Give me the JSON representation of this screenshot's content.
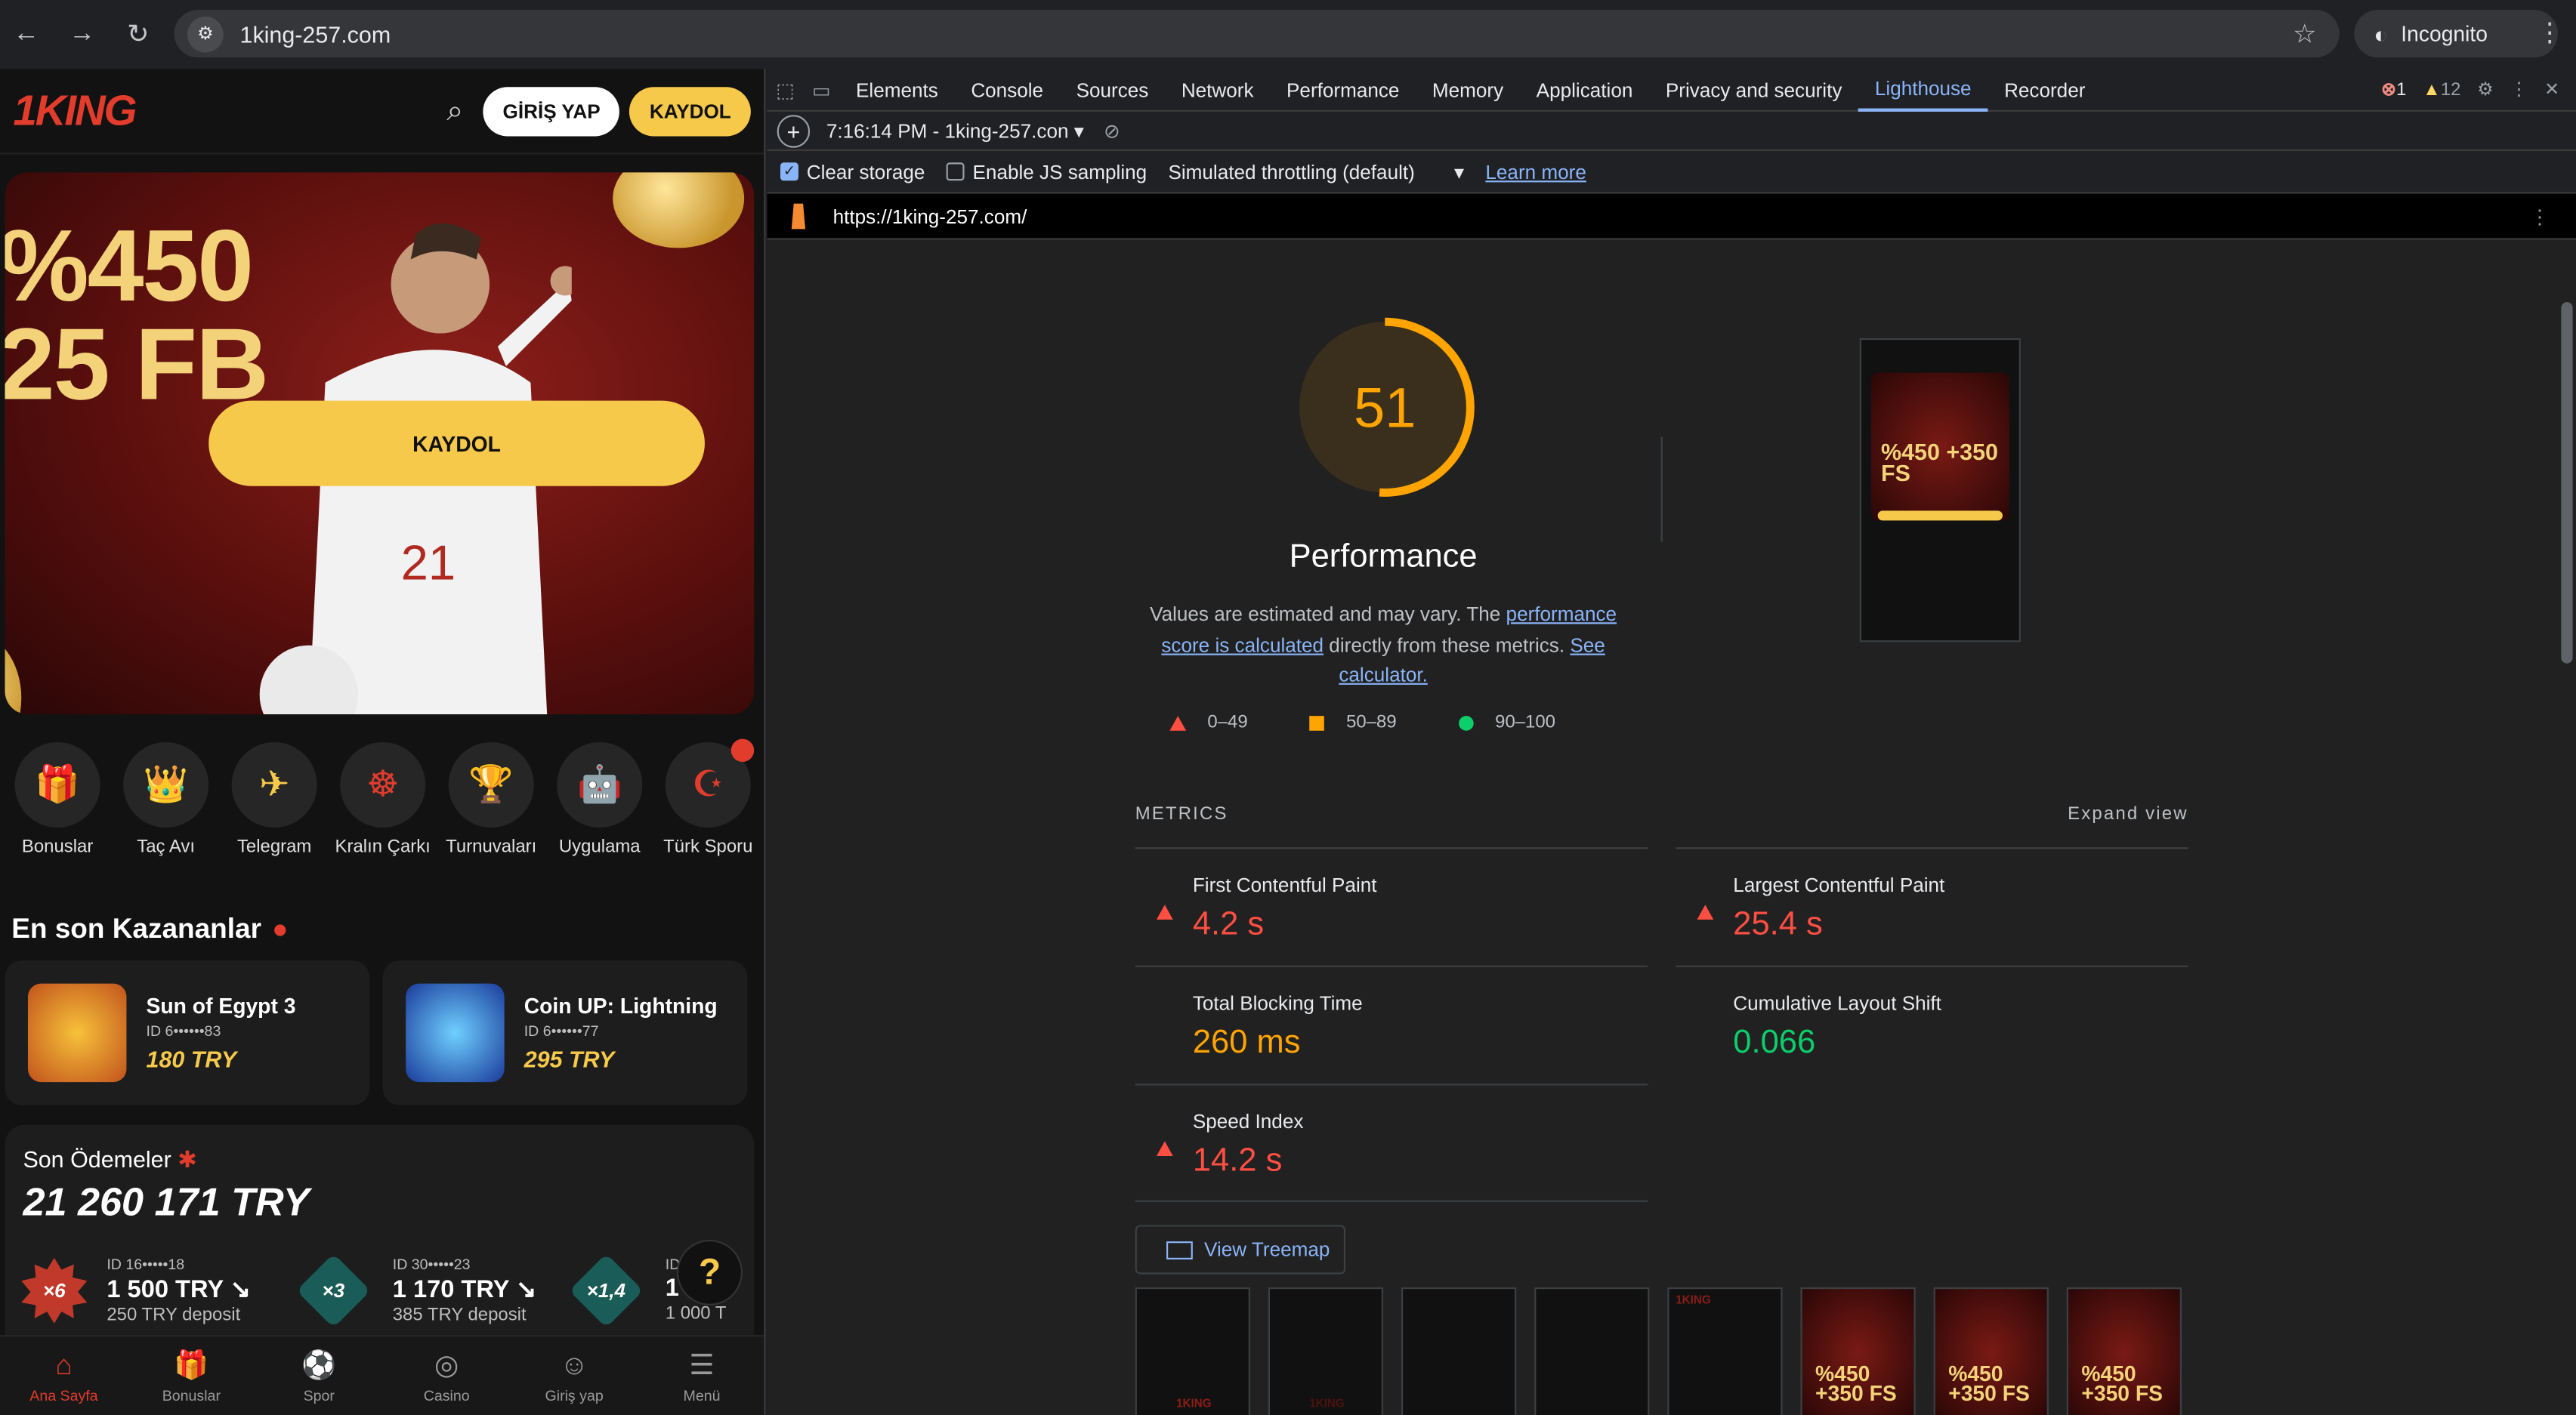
{
  "browser": {
    "url": "1king-257.com",
    "incognito_label": "Incognito"
  },
  "site": {
    "logo": "1KING",
    "login_label": "GİRİŞ YAP",
    "register_label": "KAYDOL",
    "hero": {
      "line1": "%450",
      "line2": "25 FB",
      "button": "KAYDOL"
    },
    "categories": [
      {
        "label": "Bonuslar",
        "icon": "gift-icon",
        "glyph": "🎁"
      },
      {
        "label": "Taç Avı",
        "icon": "crown-icon",
        "glyph": "👑"
      },
      {
        "label": "Telegram",
        "icon": "telegram-icon",
        "glyph": "✈"
      },
      {
        "label": "Kralın Çarkı",
        "icon": "wheel-icon",
        "glyph": "☸"
      },
      {
        "label": "Turnuvaları",
        "icon": "trophy-icon",
        "glyph": "🏆"
      },
      {
        "label": "Uygulama",
        "icon": "android-icon",
        "glyph": "🤖"
      },
      {
        "label": "Türk Sporu",
        "icon": "turkey-flag-icon",
        "glyph": "☪"
      }
    ],
    "winners_title": "En son Kazananlar",
    "winners": [
      {
        "game": "Sun of Egypt 3",
        "id": "ID 6••••••83",
        "amount": "180 TRY"
      },
      {
        "game": "Coin UP: Lightning",
        "id": "ID 6••••••77",
        "amount": "295 TRY"
      }
    ],
    "payouts": {
      "title": "Son Ödemeler",
      "total": "21 260 171 TRY",
      "items": [
        {
          "mult": "×6",
          "id": "ID 16•••••18",
          "amount": "1 500 TRY",
          "deposit": "250 TRY deposit"
        },
        {
          "mult": "×3",
          "id": "ID 30•••••23",
          "amount": "1 170 TRY",
          "deposit": "385 TRY deposit"
        },
        {
          "mult": "×1,4",
          "id": "ID",
          "amount": "1",
          "deposit": "1 000 T"
        }
      ]
    },
    "help": "?",
    "bottom_nav": [
      "Ana Sayfa",
      "Bonuslar",
      "Spor",
      "Casino",
      "Giriş yap",
      "Menü"
    ]
  },
  "devtools": {
    "tabs": [
      "Elements",
      "Console",
      "Sources",
      "Network",
      "Performance",
      "Memory",
      "Application",
      "Privacy and security",
      "Lighthouse",
      "Recorder"
    ],
    "active_tab": "Lighthouse",
    "errors": "1",
    "warnings": "12",
    "report_selector": "7:16:14 PM - 1king-257.con",
    "clear_storage": "Clear storage",
    "js_sampling": "Enable JS sampling",
    "throttling": "Simulated throttling (default)",
    "learn_more": "Learn more",
    "report_url": "https://1king-257.com/",
    "score": 51,
    "category": "Performance",
    "desc_1": "Values are estimated and may vary. The ",
    "desc_link1": "performance score is calculated",
    "desc_2": " directly from these metrics. ",
    "desc_link2": "See calculator.",
    "legend": [
      "0–49",
      "50–89",
      "90–100"
    ],
    "metrics_label": "METRICS",
    "expand_view": "Expand view",
    "metrics": [
      {
        "name": "First Contentful Paint",
        "value": "4.2 s",
        "rating": "bad"
      },
      {
        "name": "Largest Contentful Paint",
        "value": "25.4 s",
        "rating": "bad"
      },
      {
        "name": "Total Blocking Time",
        "value": "260 ms",
        "rating": "avg"
      },
      {
        "name": "Cumulative Layout Shift",
        "value": "0.066",
        "rating": "good"
      },
      {
        "name": "Speed Index",
        "value": "14.2 s",
        "rating": "bad"
      }
    ],
    "view_treemap": "View Treemap",
    "filmstrip_text": "%450 +350 FS",
    "colors": {
      "fail": "#ff4e42",
      "average": "#ffa400",
      "pass": "#0cce6b",
      "accent": "#8ab4f8"
    }
  }
}
